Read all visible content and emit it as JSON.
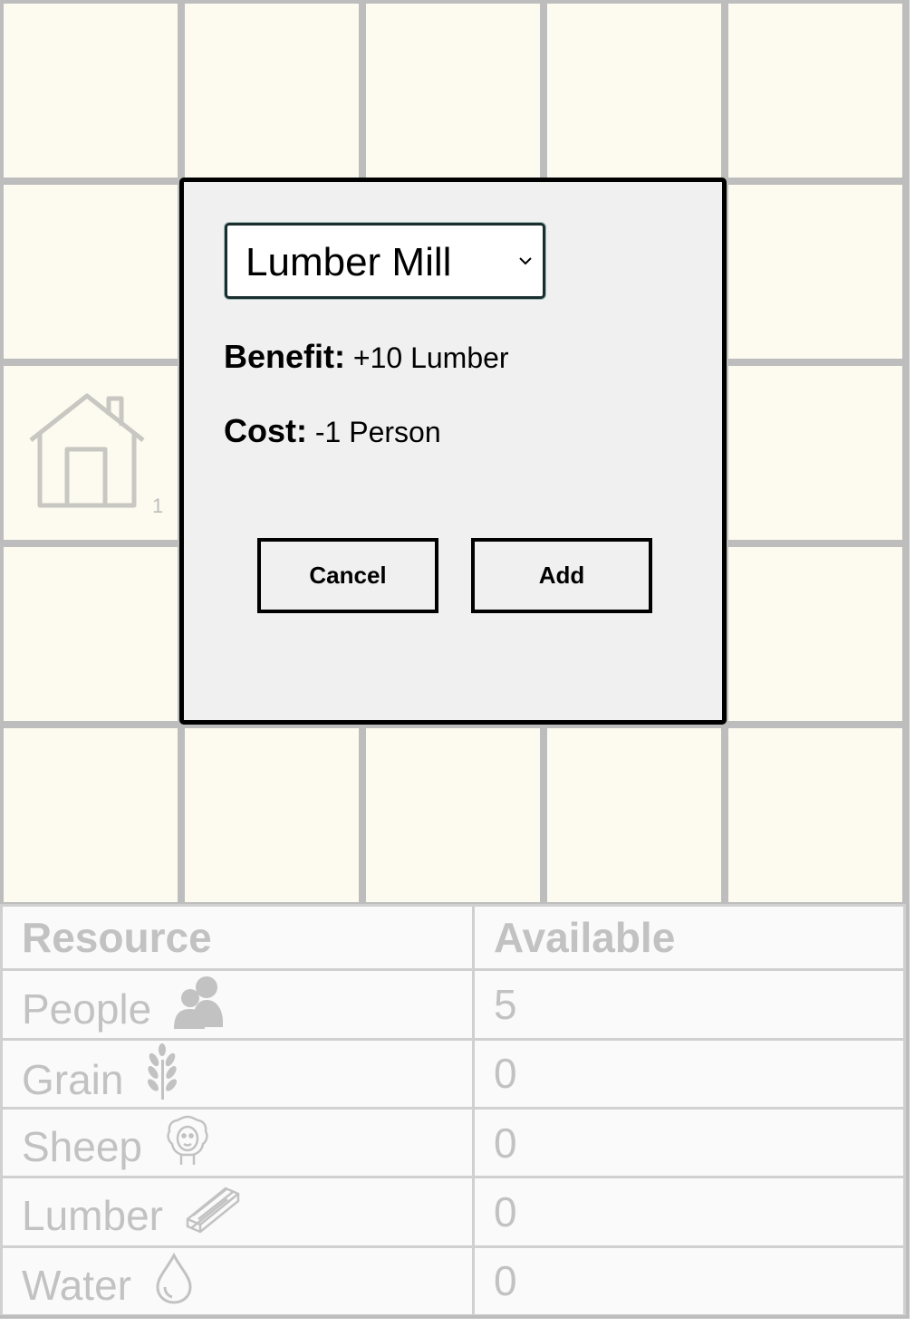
{
  "board": {
    "rows": 5,
    "cols": 5,
    "occupied": [
      {
        "row": 2,
        "col": 0,
        "building": "house-icon",
        "count": "1"
      }
    ]
  },
  "dialog": {
    "selected_building": "Lumber Mill",
    "benefit_label": "Benefit:",
    "benefit_value": "+10 Lumber",
    "cost_label": "Cost:",
    "cost_value": "-1 Person",
    "cancel_label": "Cancel",
    "add_label": "Add"
  },
  "resources": {
    "header_resource": "Resource",
    "header_available": "Available",
    "rows": [
      {
        "name": "People",
        "icon": "people-icon",
        "value": "5"
      },
      {
        "name": "Grain",
        "icon": "grain-icon",
        "value": "0"
      },
      {
        "name": "Sheep",
        "icon": "sheep-icon",
        "value": "0"
      },
      {
        "name": "Lumber",
        "icon": "lumber-icon",
        "value": "0"
      },
      {
        "name": "Water",
        "icon": "water-icon",
        "value": "0"
      }
    ]
  },
  "colors": {
    "cell_bg": "#fdfbf0",
    "grid_line": "#bdbdbd",
    "dialog_bg": "#f0f0f0",
    "muted_text": "#c2c2c2"
  }
}
